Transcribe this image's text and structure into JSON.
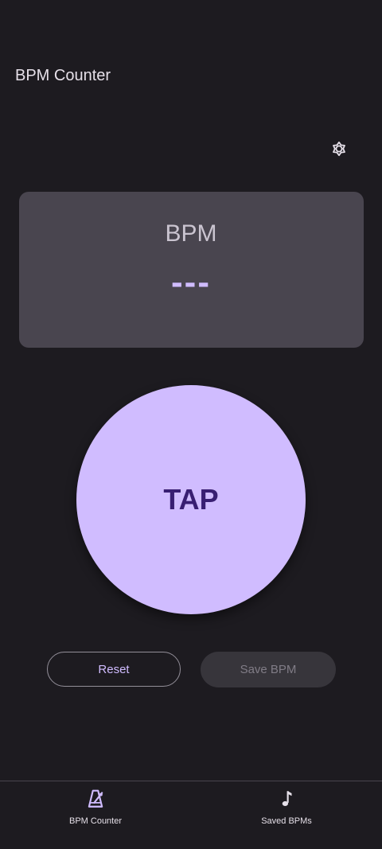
{
  "app": {
    "title": "BPM Counter"
  },
  "theme_toggle": {
    "icon": "brightness-icon"
  },
  "display": {
    "label": "BPM",
    "value": "---"
  },
  "tap_button": {
    "label": "TAP"
  },
  "actions": {
    "reset_label": "Reset",
    "save_label": "Save BPM"
  },
  "nav": {
    "items": [
      {
        "label": "BPM Counter",
        "icon": "metronome-icon",
        "active": true
      },
      {
        "label": "Saved BPMs",
        "icon": "music-note-icon",
        "active": false
      }
    ]
  },
  "colors": {
    "background": "#1d1b20",
    "card": "#49454f",
    "accent": "#d0bcff",
    "tap_text": "#381e72"
  }
}
